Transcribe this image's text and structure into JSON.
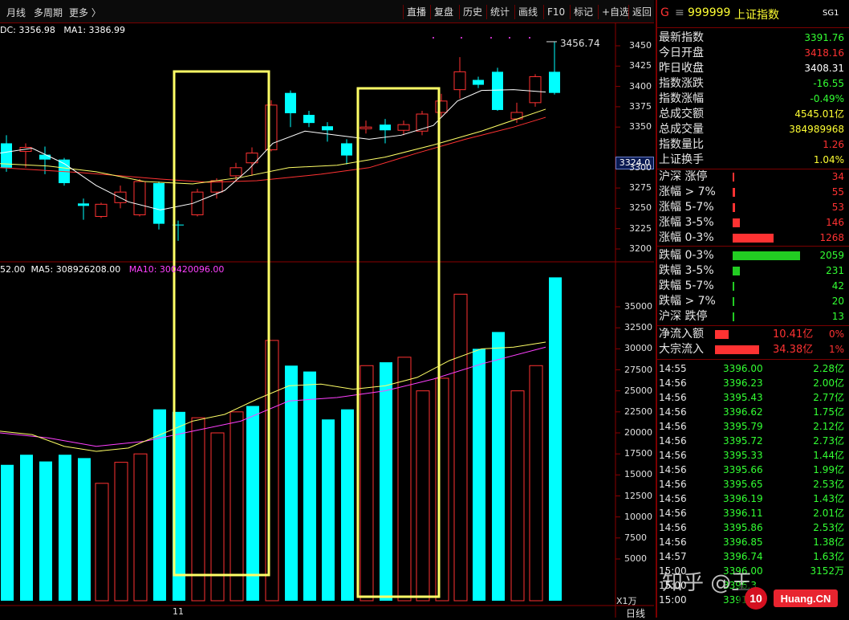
{
  "toolbar": {
    "left_items": [
      "月线",
      "多周期",
      "更多 〉"
    ],
    "buttons": [
      "直播",
      "复盘",
      "历史",
      "统计",
      "画线",
      "F10",
      "标记",
      "+自选",
      "返回"
    ]
  },
  "chart": {
    "price_info": {
      "prefix": "DC: 3356.98",
      "ma1": "MA1: 3386.99"
    },
    "high_label": "3456.74",
    "current_price_tag": "3324.0",
    "price_axis": [
      "3450",
      "3425",
      "3400",
      "3375",
      "3350",
      "3300",
      "3275",
      "3250",
      "3225",
      "3200"
    ],
    "volume_info": {
      "prefix": "52.00",
      "ma5": "MA5: 308926208.00",
      "ma10": "MA10: 300420096.00"
    },
    "volume_axis": [
      "35000",
      "32500",
      "30000",
      "27500",
      "25000",
      "22500",
      "20000",
      "17500",
      "15000",
      "12500",
      "10000",
      "7500",
      "5000"
    ],
    "volume_unit": "X1万",
    "x_label": "11",
    "bottom_tab": "日线",
    "colors": {
      "up": "#ff3232",
      "down": "#00ffff",
      "ma_white": "#ffffff",
      "ma_yellow": "#ffff66",
      "ma_magenta": "#ff40ff",
      "highlight": "#ffff66"
    }
  },
  "panel": {
    "header": {
      "badge": "G",
      "code": "999999",
      "name": "上证指数",
      "tag": "SG1"
    },
    "quote": [
      {
        "label": "最新指数",
        "value": "3391.76",
        "color": "green"
      },
      {
        "label": "今日开盘",
        "value": "3418.16",
        "color": "red"
      },
      {
        "label": "昨日收盘",
        "value": "3408.31",
        "color": "white"
      },
      {
        "label": "指数涨跌",
        "value": "-16.55",
        "color": "green"
      },
      {
        "label": "指数涨幅",
        "value": "-0.49%",
        "color": "green"
      },
      {
        "label": "总成交额",
        "value": "4545.01亿",
        "color": "yellow"
      },
      {
        "label": "总成交量",
        "value": "384989968",
        "color": "yellow"
      },
      {
        "label": "指数量比",
        "value": "1.26",
        "color": "red"
      },
      {
        "label": "上证换手",
        "value": "1.04%",
        "color": "yellow"
      }
    ],
    "rise": [
      {
        "label": "沪深 涨停",
        "value": "34",
        "bar": 0.02
      },
      {
        "label": "涨幅 > 7%",
        "value": "55",
        "bar": 0.04
      },
      {
        "label": "涨幅 5-7%",
        "value": "53",
        "bar": 0.04
      },
      {
        "label": "涨幅 3-5%",
        "value": "146",
        "bar": 0.1
      },
      {
        "label": "涨幅 0-3%",
        "value": "1268",
        "bar": 0.6
      }
    ],
    "fall": [
      {
        "label": "跌幅 0-3%",
        "value": "2059",
        "bar": 1.0
      },
      {
        "label": "跌幅 3-5%",
        "value": "231",
        "bar": 0.11
      },
      {
        "label": "跌幅 5-7%",
        "value": "42",
        "bar": 0.02
      },
      {
        "label": "跌幅 > 7%",
        "value": "20",
        "bar": 0.01
      },
      {
        "label": "沪深 跌停",
        "value": "13",
        "bar": 0.01
      }
    ],
    "flows": [
      {
        "label": "净流入额",
        "amount": "10.41亿",
        "pct": "0%",
        "bar": 0.3
      },
      {
        "label": "大宗流入",
        "amount": "34.38亿",
        "pct": "1%",
        "bar": 1.0
      }
    ],
    "ticks": [
      {
        "time": "14:55",
        "price": "3396.00",
        "vol": "2.28亿"
      },
      {
        "time": "14:56",
        "price": "3396.23",
        "vol": "2.00亿"
      },
      {
        "time": "14:56",
        "price": "3395.43",
        "vol": "2.77亿"
      },
      {
        "time": "14:56",
        "price": "3396.62",
        "vol": "1.75亿"
      },
      {
        "time": "14:56",
        "price": "3395.79",
        "vol": "2.12亿"
      },
      {
        "time": "14:56",
        "price": "3395.72",
        "vol": "2.73亿"
      },
      {
        "time": "14:56",
        "price": "3395.33",
        "vol": "1.44亿"
      },
      {
        "time": "14:56",
        "price": "3395.66",
        "vol": "1.99亿"
      },
      {
        "time": "14:56",
        "price": "3395.65",
        "vol": "2.53亿"
      },
      {
        "time": "14:56",
        "price": "3396.19",
        "vol": "1.43亿"
      },
      {
        "time": "14:56",
        "price": "3396.11",
        "vol": "2.01亿"
      },
      {
        "time": "14:56",
        "price": "3395.86",
        "vol": "2.53亿"
      },
      {
        "time": "14:56",
        "price": "3396.85",
        "vol": "1.38亿"
      },
      {
        "time": "14:57",
        "price": "3396.74",
        "vol": "1.63亿"
      },
      {
        "time": "15:00",
        "price": "3396.00",
        "vol": "3152万"
      },
      {
        "time": "15:00",
        "price": "3396.3",
        "vol": ""
      },
      {
        "time": "15:00",
        "price": "3391.76",
        "vol": ""
      }
    ]
  },
  "watermark": {
    "text": "知乎 @王",
    "logo_text": "10huang.cn"
  }
}
